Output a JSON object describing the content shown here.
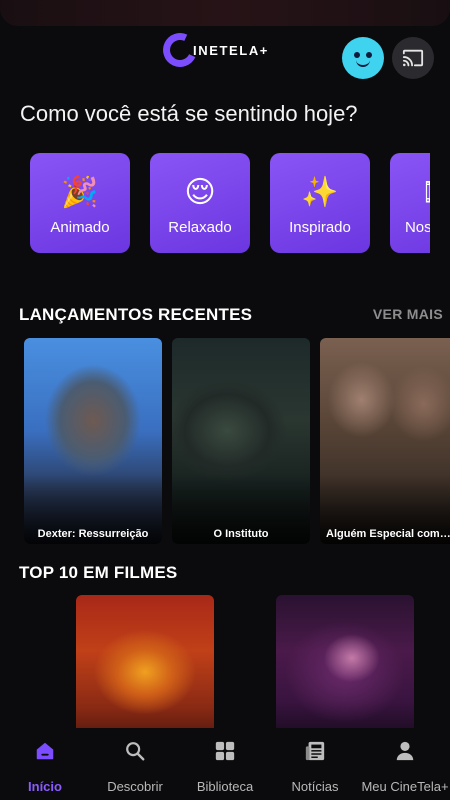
{
  "header": {
    "logo_text": "INETELA+",
    "avatar_icon": "smiley-avatar-icon",
    "cast_icon": "cast-icon",
    "accent": "#7b4dff"
  },
  "mood": {
    "title": "Como você está se sentindo hoje?",
    "cards": [
      {
        "emoji": "🎉",
        "label": "Animado"
      },
      {
        "emoji": "😌",
        "label": "Relaxado"
      },
      {
        "emoji": "✨",
        "label": "Inspirado"
      },
      {
        "emoji": "🎞",
        "label": "Nostálgico"
      }
    ]
  },
  "recent": {
    "title": "LANÇAMENTOS RECENTES",
    "see_more": "VER MAIS",
    "items": [
      {
        "title": "Dexter: Ressurreição"
      },
      {
        "title": "O Instituto"
      },
      {
        "title": "Alguém Especial como..."
      }
    ]
  },
  "top10": {
    "title": "TOP 10 EM FILMES"
  },
  "nav": {
    "items": [
      {
        "label": "Início",
        "icon": "home-icon",
        "active": true
      },
      {
        "label": "Descobrir",
        "icon": "search-icon",
        "active": false
      },
      {
        "label": "Biblioteca",
        "icon": "grid-icon",
        "active": false
      },
      {
        "label": "Notícias",
        "icon": "news-icon",
        "active": false
      },
      {
        "label": "Meu CineTela+",
        "icon": "user-icon",
        "active": false
      }
    ],
    "active_color": "#8a5cff"
  }
}
